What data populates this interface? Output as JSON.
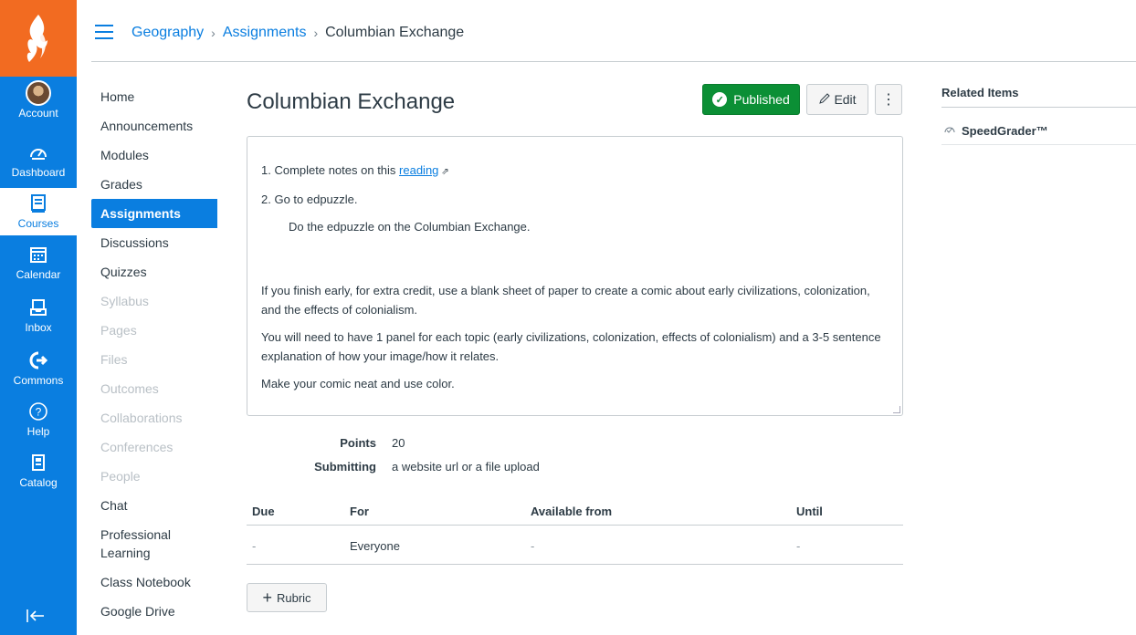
{
  "global_nav": {
    "items": [
      {
        "label": "Account",
        "icon": "avatar"
      },
      {
        "label": "Dashboard",
        "icon": "dashboard-icon"
      },
      {
        "label": "Courses",
        "icon": "courses-icon",
        "active": true
      },
      {
        "label": "Calendar",
        "icon": "calendar-icon"
      },
      {
        "label": "Inbox",
        "icon": "inbox-icon"
      },
      {
        "label": "Commons",
        "icon": "commons-icon"
      },
      {
        "label": "Help",
        "icon": "help-icon"
      },
      {
        "label": "Catalog",
        "icon": "catalog-icon"
      }
    ],
    "colors": {
      "nav_bg": "#0a7ee0",
      "logo_bg": "#f26b21"
    }
  },
  "breadcrumb": {
    "items": [
      "Geography",
      "Assignments",
      "Columbian Exchange"
    ],
    "separator": "›"
  },
  "course_nav": {
    "items": [
      {
        "label": "Home"
      },
      {
        "label": "Announcements"
      },
      {
        "label": "Modules"
      },
      {
        "label": "Grades"
      },
      {
        "label": "Assignments",
        "active": true
      },
      {
        "label": "Discussions"
      },
      {
        "label": "Quizzes"
      },
      {
        "label": "Syllabus",
        "disabled": true
      },
      {
        "label": "Pages",
        "disabled": true
      },
      {
        "label": "Files",
        "disabled": true
      },
      {
        "label": "Outcomes",
        "disabled": true
      },
      {
        "label": "Collaborations",
        "disabled": true
      },
      {
        "label": "Conferences",
        "disabled": true
      },
      {
        "label": "People",
        "disabled": true
      },
      {
        "label": "Chat"
      },
      {
        "label": "Professional Learning"
      },
      {
        "label": "Class Notebook"
      },
      {
        "label": "Google Drive"
      }
    ]
  },
  "assignment": {
    "title": "Columbian Exchange",
    "published_label": "Published",
    "edit_label": "Edit",
    "description": {
      "item1_prefix": "1. Complete notes on this ",
      "item1_link": "reading",
      "item2": "2. Go to edpuzzle.",
      "item2_sub": "Do the edpuzzle on the Columbian Exchange.",
      "para1": "If you finish early, for extra credit, use a blank sheet of paper to create a comic about early civilizations, colonization, and the effects of colonialism.",
      "para2": "You will need to have 1 panel for each topic (early civilizations, colonization, effects of colonialism) and a 3-5 sentence explanation of how your image/how it relates.",
      "para3": "Make your comic neat and use color."
    },
    "points_label": "Points",
    "points_value": "20",
    "submitting_label": "Submitting",
    "submitting_value": "a website url or a file upload",
    "dates_table": {
      "headers": [
        "Due",
        "For",
        "Available from",
        "Until"
      ],
      "row": [
        "-",
        "Everyone",
        "-",
        "-"
      ]
    },
    "rubric_label": "Rubric"
  },
  "related": {
    "title": "Related Items",
    "speedgrader": "SpeedGrader™"
  }
}
